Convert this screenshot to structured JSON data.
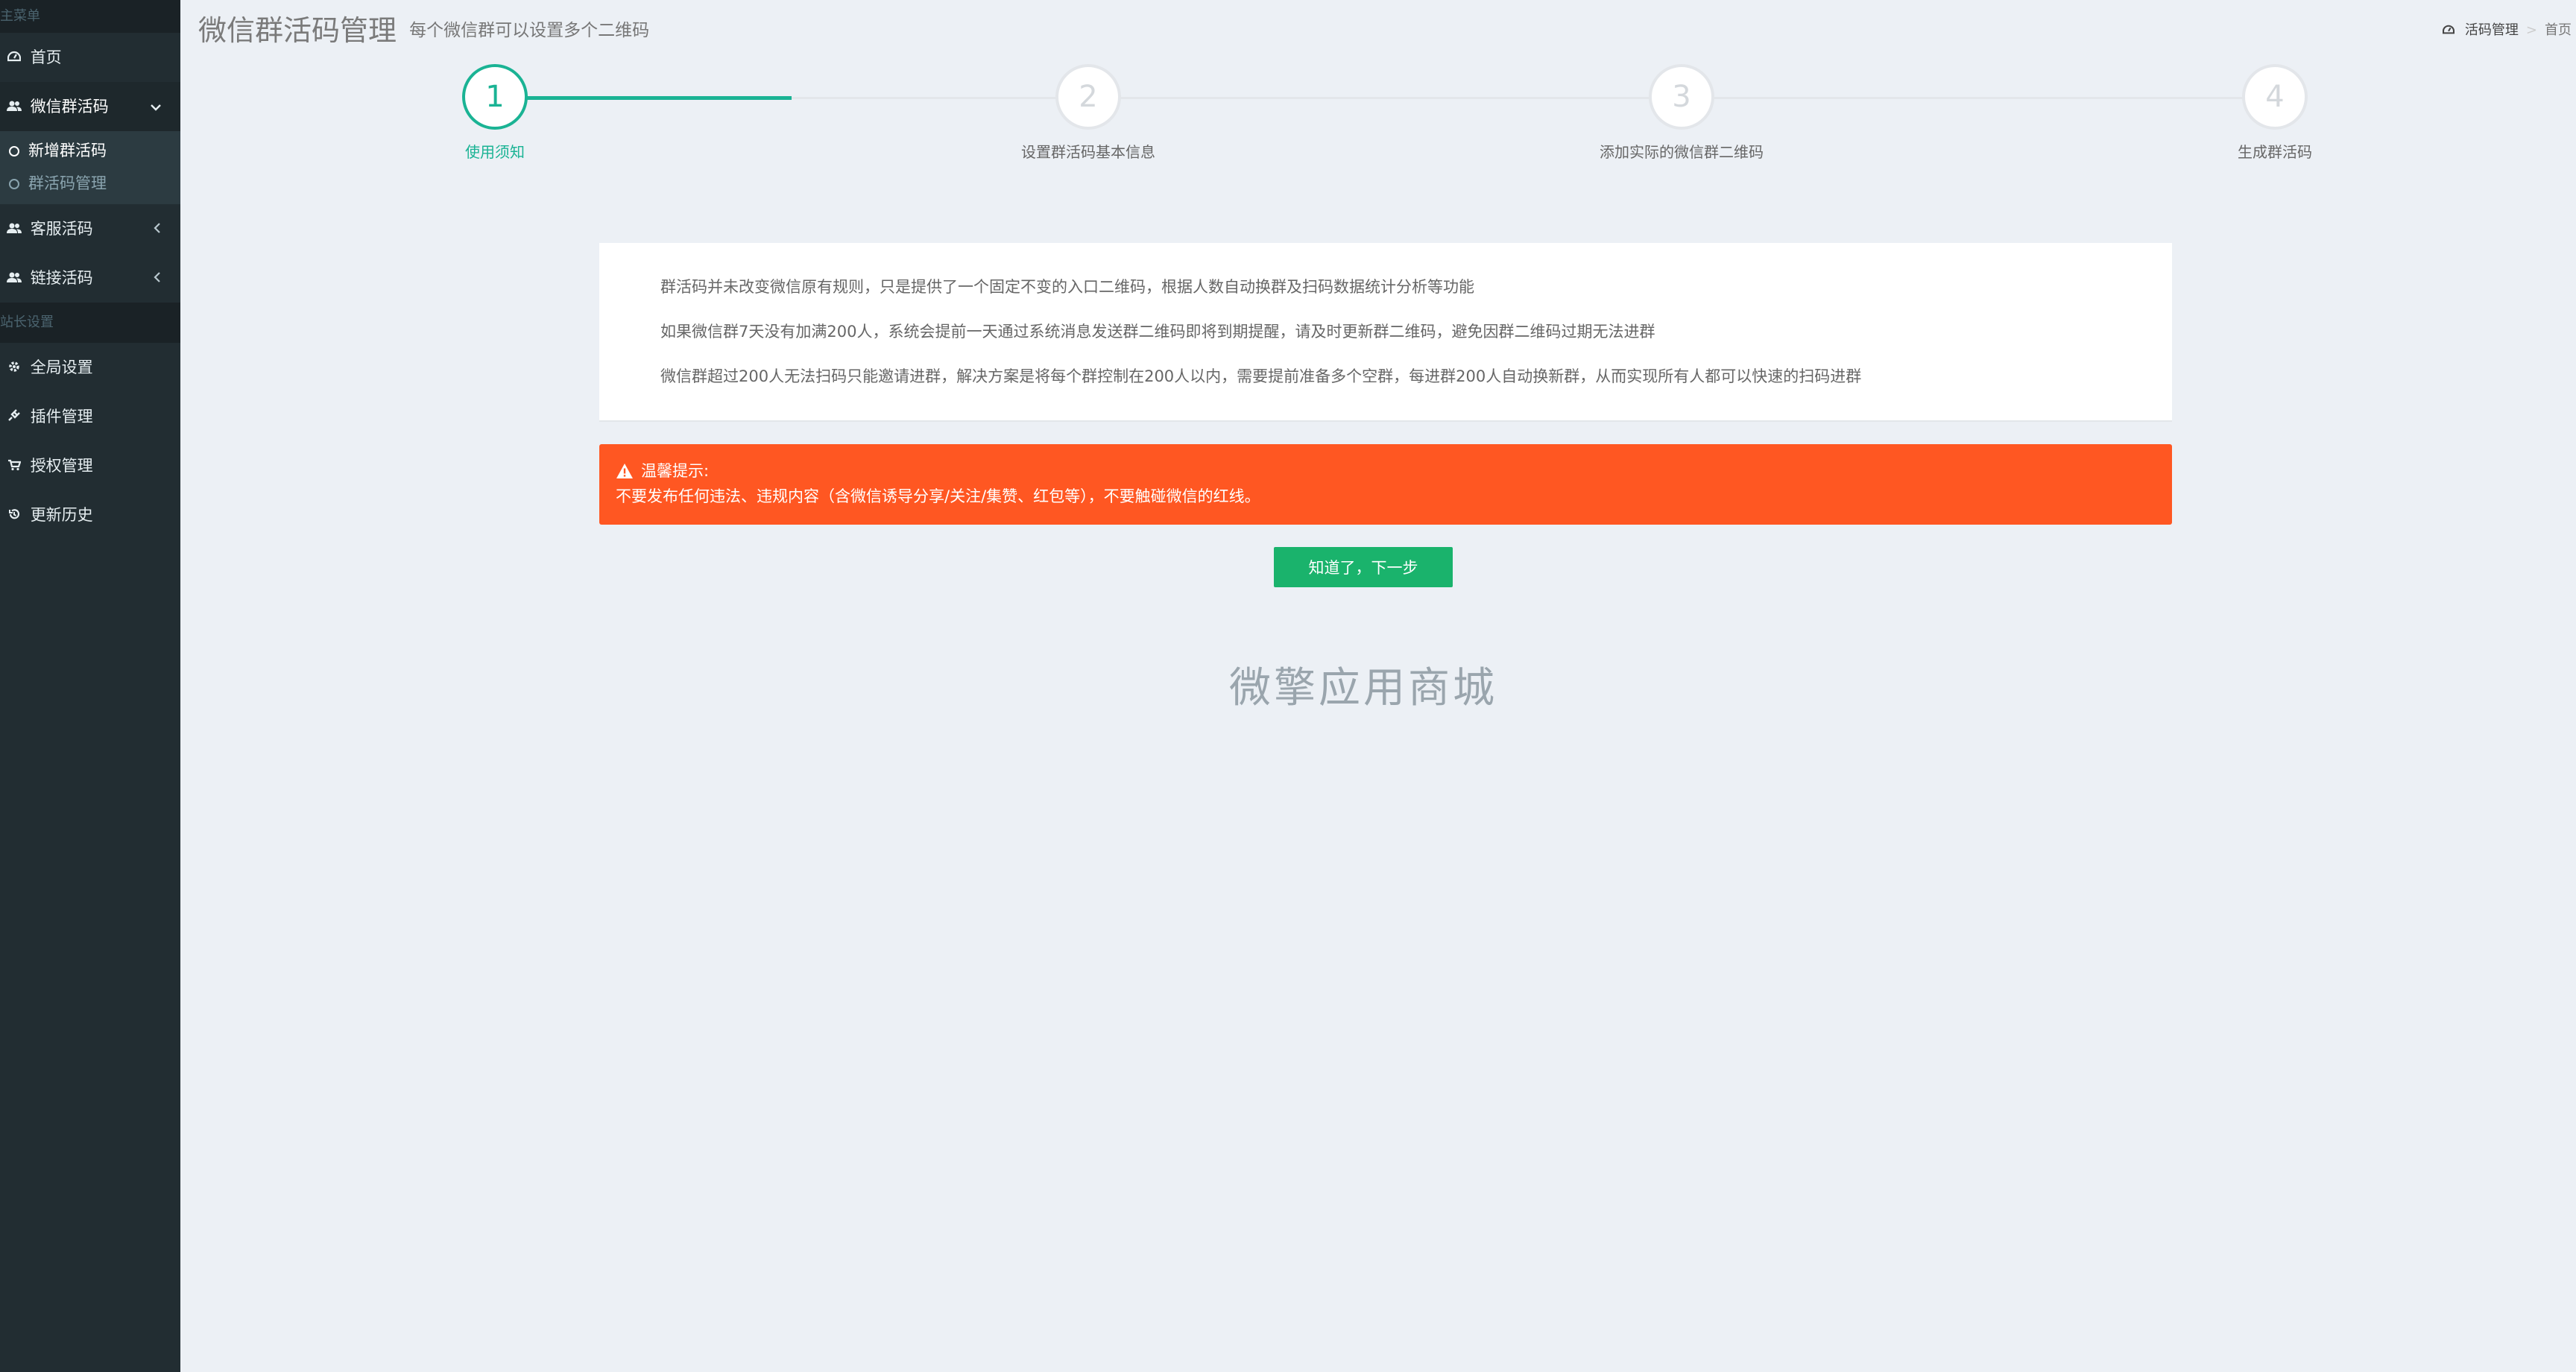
{
  "sidebar": {
    "header": "主菜单",
    "items": [
      {
        "label": "首页"
      },
      {
        "label": "微信群活码"
      },
      {
        "label": "客服活码"
      },
      {
        "label": "链接活码"
      }
    ],
    "submenu": [
      {
        "label": "新增群活码"
      },
      {
        "label": "群活码管理"
      }
    ],
    "section": "站长设置",
    "settings": [
      {
        "label": "全局设置"
      },
      {
        "label": "插件管理"
      },
      {
        "label": "授权管理"
      },
      {
        "label": "更新历史"
      }
    ]
  },
  "header": {
    "title": "微信群活码管理",
    "subtitle": "每个微信群可以设置多个二维码"
  },
  "breadcrumb": {
    "first": "活码管理",
    "separator": ">",
    "last": "首页"
  },
  "steps": [
    {
      "num": "1",
      "label": "使用须知"
    },
    {
      "num": "2",
      "label": "设置群活码基本信息"
    },
    {
      "num": "3",
      "label": "添加实际的微信群二维码"
    },
    {
      "num": "4",
      "label": "生成群活码"
    }
  ],
  "current_step": 1,
  "notice": {
    "lines": [
      "群活码并未改变微信原有规则，只是提供了一个固定不变的入口二维码，根据人数自动换群及扫码数据统计分析等功能",
      "如果微信群7天没有加满200人，系统会提前一天通过系统消息发送群二维码即将到期提醒，请及时更新群二维码，避免因群二维码过期无法进群",
      "微信群超过200人无法扫码只能邀请进群，解决方案是将每个群控制在200人以内，需要提前准备多个空群，每进群200人自动换新群，从而实现所有人都可以快速的扫码进群"
    ]
  },
  "warning": {
    "title": "温馨提示:",
    "body": "不要发布任何违法、违规内容（含微信诱导分享/关注/集赞、红包等），不要触碰微信的红线。"
  },
  "next_button": "知道了，下一步",
  "brand": "微擎应用商城",
  "colors": {
    "sidebar_bg": "#222d32",
    "accent": "#1ab394",
    "button": "#1ab36c",
    "warning": "#ff5722",
    "page_bg": "#ecf0f5"
  }
}
